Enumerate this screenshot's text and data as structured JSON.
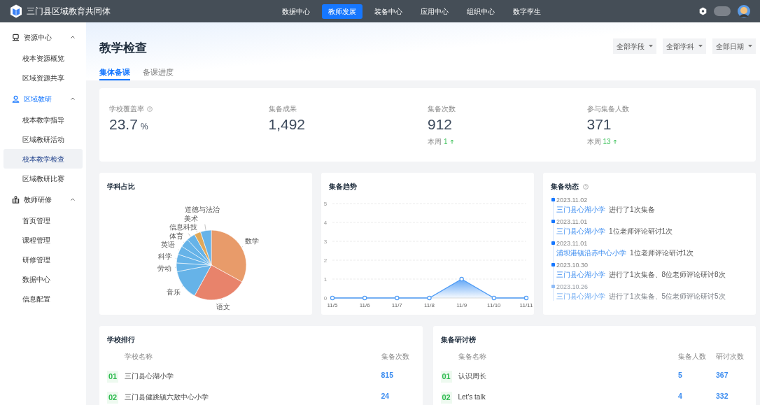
{
  "app": {
    "title": "三门县区域教育共同体"
  },
  "top_nav": [
    {
      "label": "数据中心",
      "selected": false
    },
    {
      "label": "教师发展",
      "selected": true
    },
    {
      "label": "装备中心",
      "selected": false
    },
    {
      "label": "应用中心",
      "selected": false
    },
    {
      "label": "组织中心",
      "selected": false
    },
    {
      "label": "数字孪生",
      "selected": false
    }
  ],
  "sidebar": {
    "groups": [
      {
        "label": "资源中心",
        "kind": "monitor",
        "selected": false,
        "expanded": true,
        "items": [
          {
            "label": "校本资源概览",
            "selected": false
          },
          {
            "label": "区域资源共享",
            "selected": false
          }
        ]
      },
      {
        "label": "区域教研",
        "kind": "person",
        "selected": true,
        "expanded": true,
        "items": [
          {
            "label": "校本教学指导",
            "selected": false
          },
          {
            "label": "区域教研活动",
            "selected": false
          },
          {
            "label": "校本教学检查",
            "selected": true
          },
          {
            "label": "区域教研比赛",
            "selected": false
          }
        ]
      },
      {
        "label": "教师研修",
        "kind": "cube",
        "selected": false,
        "expanded": true,
        "items": [
          {
            "label": "首页管理",
            "selected": false
          },
          {
            "label": "课程管理",
            "selected": false
          },
          {
            "label": "研修管理",
            "selected": false
          },
          {
            "label": "数据中心",
            "selected": false
          },
          {
            "label": "信息配置",
            "selected": false
          }
        ]
      }
    ]
  },
  "page": {
    "title": "教学检查",
    "filters": [
      "全部学段",
      "全部学科",
      "全部日期"
    ],
    "tabs": [
      {
        "label": "集体备课",
        "selected": true
      },
      {
        "label": "备课进度",
        "selected": false
      }
    ]
  },
  "stats": [
    {
      "label": "学校覆盖率",
      "help": true,
      "value": "23.7",
      "unit": "%"
    },
    {
      "label": "集备成果",
      "help": false,
      "value": "1,492"
    },
    {
      "label": "集备次数",
      "help": false,
      "value": "912",
      "week_label": "本周",
      "week_value": "1"
    },
    {
      "label": "参与集备人数",
      "help": false,
      "value": "371",
      "week_label": "本周",
      "week_value": "13"
    }
  ],
  "subject_share": {
    "title": "学科占比",
    "labels": [
      "道德与法治",
      "美术",
      "信息科技",
      "体育",
      "数学",
      "英语",
      "科学",
      "劳动",
      "音乐",
      "语文"
    ]
  },
  "trend": {
    "title": "集备趋势",
    "chart_data": {
      "type": "area",
      "x": [
        "11/5",
        "11/6",
        "11/7",
        "11/8",
        "11/9",
        "11/10",
        "11/11"
      ],
      "series": [
        {
          "color": "#4e9bf5",
          "values": [
            0,
            0,
            0,
            0,
            1,
            0,
            0
          ]
        }
      ],
      "grid": true,
      "ylim": [
        0,
        5
      ],
      "yticks": [
        0,
        1,
        2,
        3,
        4,
        5
      ]
    }
  },
  "activity": {
    "title": "集备动态",
    "help": true,
    "items": [
      {
        "date": "2023.11.02",
        "school": "三门县心湖小学",
        "text": "进行了1次集备",
        "faded": false
      },
      {
        "date": "2023.11.01",
        "school": "三门县心湖小学",
        "text": "1位老师评论研讨1次",
        "faded": false
      },
      {
        "date": "2023.11.01",
        "school": "浦坝港镇沿赤中心小学",
        "text": "1位老师评论研讨1次",
        "faded": false
      },
      {
        "date": "2023.10.30",
        "school": "三门县心湖小学",
        "text": "进行了1次集备、8位老师评论研讨8次",
        "faded": false
      },
      {
        "date": "2023.10.26",
        "school": "三门县心湖小学",
        "text": "进行了1次集备、5位老师评论研讨5次",
        "faded": true
      }
    ]
  },
  "school_ranking": {
    "title": "学校排行",
    "columns": [
      "学校名称",
      "集备次数"
    ],
    "rows": [
      {
        "rank": "01",
        "name": "三门县心湖小学",
        "count": "815"
      },
      {
        "rank": "02",
        "name": "三门县健跳镇六敖中心小学",
        "count": "24"
      }
    ]
  },
  "discussion_ranking": {
    "title": "集备研讨榜",
    "columns": [
      "集备名称",
      "集备人数",
      "研讨次数"
    ],
    "rows": [
      {
        "rank": "01",
        "name": "认识周长",
        "people": "5",
        "count": "367"
      },
      {
        "rank": "02",
        "name": "Let's talk",
        "people": "4",
        "count": "332"
      }
    ]
  }
}
